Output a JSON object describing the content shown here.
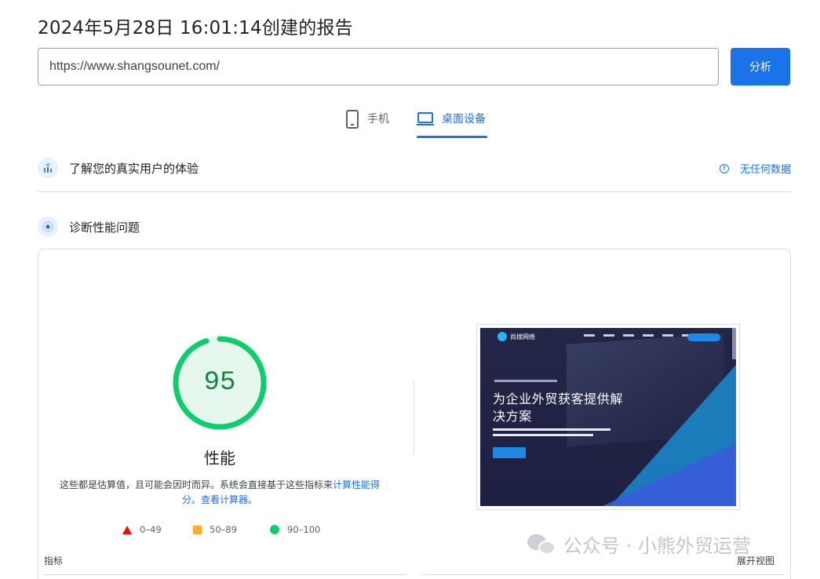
{
  "report": {
    "title": "2024年5月28日 16:01:14创建的报告"
  },
  "url_bar": {
    "value": "https://www.shangsounet.com/",
    "analyze_label": "分析"
  },
  "device_tabs": [
    {
      "label": "手机",
      "icon": "smartphone-icon",
      "active": false
    },
    {
      "label": "桌面设备",
      "icon": "laptop-icon",
      "active": true
    }
  ],
  "field_data": {
    "label": "了解您的真实用户的体验",
    "no_data_label": "无任何数据"
  },
  "diagnostics": {
    "label": "诊断性能问题"
  },
  "performance": {
    "score": "95",
    "score_fraction": 0.95,
    "label": "性能",
    "disclaimer_text": "这些都是估算值，且可能会因时而异。系统会直接基于这些指标来",
    "calc_link": "计算性能得分。",
    "calculator_link": "查看计算器。"
  },
  "legend": [
    {
      "shape": "triangle",
      "range": "0–49",
      "color": "#eb0f00"
    },
    {
      "shape": "square",
      "range": "50–89",
      "color": "#ffaa33"
    },
    {
      "shape": "circle",
      "range": "90–100",
      "color": "#0cce6b"
    }
  ],
  "screenshot": {
    "site_name": "尚搜网络",
    "headline": "为企业外贸获客提供解决方案"
  },
  "metrics": {
    "label": "指标",
    "expand_label": "展开视图"
  },
  "watermark": {
    "text": "公众号 · 小熊外贸运营"
  },
  "colors": {
    "accent": "#1a73e8",
    "pass": "#0cce6b",
    "pass_text": "#0a8a3a",
    "average": "#ffaa33",
    "fail": "#eb0f00"
  }
}
